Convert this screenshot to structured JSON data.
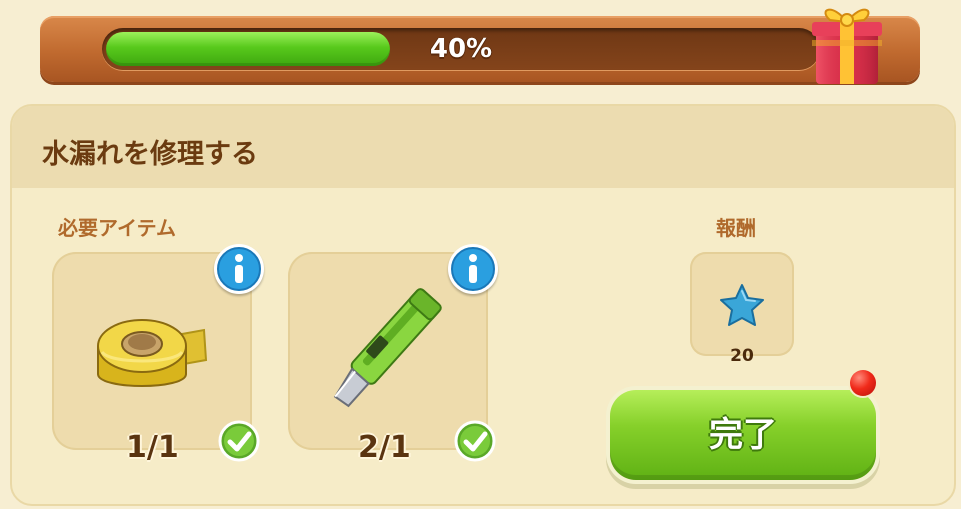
{
  "progress": {
    "value": 0.4,
    "label": "40%"
  },
  "quest": {
    "title": "水漏れを修理する"
  },
  "required_items": {
    "label": "必要アイテム",
    "items": [
      {
        "icon": "tape-roll-icon",
        "count": "1/1",
        "completed": true
      },
      {
        "icon": "utility-knife-icon",
        "count": "2/1",
        "completed": true
      }
    ]
  },
  "reward": {
    "label": "報酬",
    "icon": "blue-star-icon",
    "amount": "20"
  },
  "complete_button": {
    "label": "完了",
    "has_notification": true
  },
  "colors": {
    "progress_fill": "#58c91c",
    "banner": "#c06a2f",
    "title_text": "#6b3b10",
    "button_green": "#86d02a",
    "info_blue": "#2a9fe0"
  }
}
